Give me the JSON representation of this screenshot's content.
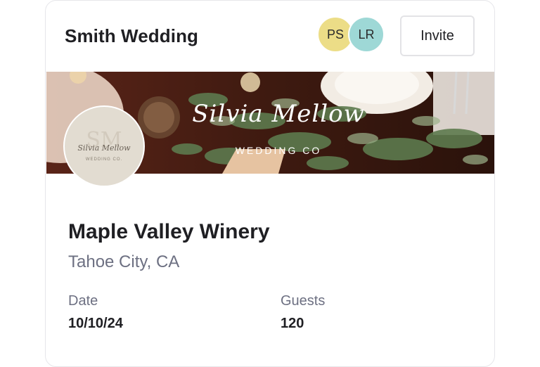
{
  "header": {
    "title": "Smith Wedding",
    "invite_label": "Invite"
  },
  "collaborators": [
    {
      "initials": "PS",
      "color": "#ecdd87"
    },
    {
      "initials": "LR",
      "color": "#9ed8d6"
    }
  ],
  "banner": {
    "brand_name": "Silvia Mellow",
    "brand_sub": "WEDDING CO"
  },
  "logo": {
    "monogram": "SM",
    "script": "Silvia Mellow",
    "sub": "WEDDING CO."
  },
  "venue": {
    "name": "Maple Valley Winery",
    "location": "Tahoe City, CA"
  },
  "details": {
    "date_label": "Date",
    "date_value": "10/10/24",
    "guests_label": "Guests",
    "guests_value": "120"
  }
}
